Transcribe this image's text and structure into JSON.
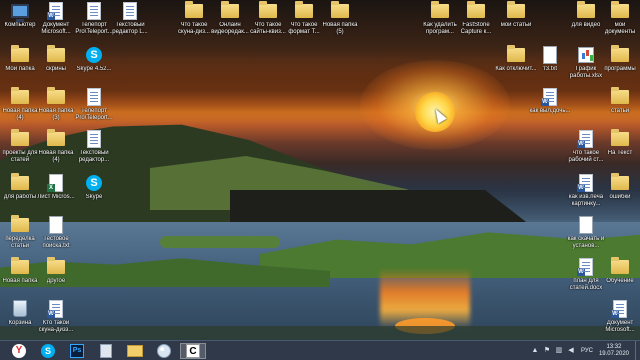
{
  "desktop": {
    "icons": [
      {
        "label": "Компьютер",
        "type": "computer"
      },
      {
        "label": "Документ Microsoft...",
        "type": "word"
      },
      {
        "label": "Телепорт Pro\\Teleport...",
        "type": "doc"
      },
      {
        "label": "Текстовый редактор L...",
        "type": "doc"
      },
      {
        "label": "Что такое скуна-диз...",
        "type": "folder"
      },
      {
        "label": "Онлайн видеоредак...",
        "type": "folder"
      },
      {
        "label": "Что такое сайты-квиз...",
        "type": "folder"
      },
      {
        "label": "Что такое формат Т...",
        "type": "folder"
      },
      {
        "label": "Новая папка (5)",
        "type": "folder"
      },
      {
        "label": "Как удалить програм...",
        "type": "folder"
      },
      {
        "label": "FastStone Capture к...",
        "type": "folder"
      },
      {
        "label": "мои статьи",
        "type": "folder"
      },
      {
        "label": "для видео",
        "type": "folder"
      },
      {
        "label": "мои документы",
        "type": "folder"
      },
      {
        "label": "Мои папка",
        "type": "folder"
      },
      {
        "label": "скрины",
        "type": "folder"
      },
      {
        "label": "Skype 4.52...",
        "type": "skype"
      },
      {
        "label": "Как отключит...",
        "type": "folder"
      },
      {
        "label": "т3.txt",
        "type": "txt"
      },
      {
        "label": "График работы.xlsx",
        "type": "graph"
      },
      {
        "label": "программы",
        "type": "folder"
      },
      {
        "label": "Новая папка (4)",
        "type": "folder"
      },
      {
        "label": "Новая папка (3)",
        "type": "folder"
      },
      {
        "label": "Телепорт Pro\\Teleport...",
        "type": "doc"
      },
      {
        "label": "как выл.дочь...",
        "type": "word"
      },
      {
        "label": "статьи",
        "type": "folder"
      },
      {
        "label": "проекты для статей",
        "type": "folder"
      },
      {
        "label": "Новая папка (4)",
        "type": "folder"
      },
      {
        "label": "Текстовый редактор...",
        "type": "doc"
      },
      {
        "label": "что такое рабочий ст...",
        "type": "word"
      },
      {
        "label": "На Текст",
        "type": "folder"
      },
      {
        "label": "для работы",
        "type": "folder"
      },
      {
        "label": "Лист Micros...",
        "type": "excel"
      },
      {
        "label": "Skype",
        "type": "skype"
      },
      {
        "label": "как изв.печа картинку...",
        "type": "word"
      },
      {
        "label": "ошибки",
        "type": "folder"
      },
      {
        "label": "переделка статьи",
        "type": "folder"
      },
      {
        "label": "Тестовое поиска.txt",
        "type": "txt"
      },
      {
        "label": "как скачать и установ...",
        "type": "txt"
      },
      {
        "label": "Новая папка",
        "type": "folder"
      },
      {
        "label": "другое",
        "type": "folder"
      },
      {
        "label": "план для статей.docx",
        "type": "word"
      },
      {
        "label": "Обучение",
        "type": "folder"
      },
      {
        "label": "Корзина",
        "type": "recycle"
      },
      {
        "label": "Кто такой скуна-дизз...",
        "type": "word"
      },
      {
        "label": "Документ Microsoft...",
        "type": "word"
      }
    ]
  },
  "taskbar": {
    "apps": [
      {
        "label": "Y",
        "name": "yandex-browser"
      },
      {
        "label": "S",
        "name": "skype"
      },
      {
        "label": "Ps",
        "name": "photoshop"
      },
      {
        "label": "",
        "name": "document"
      },
      {
        "label": "",
        "name": "file-explorer"
      },
      {
        "label": "",
        "name": "paint"
      },
      {
        "label": "C",
        "name": "capture-app"
      }
    ],
    "language": "РУС",
    "time": "13:32",
    "date": "19.07.2020"
  }
}
